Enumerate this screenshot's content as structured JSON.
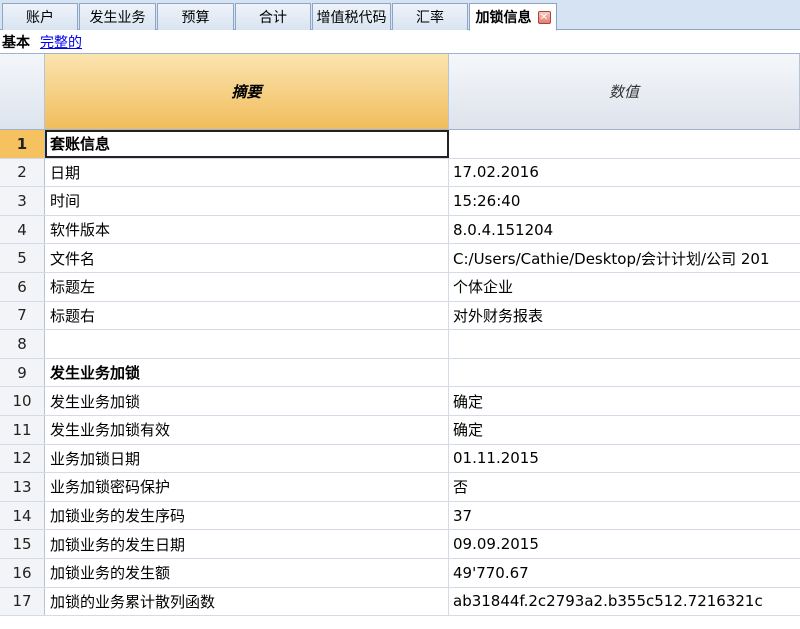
{
  "tabs": [
    {
      "label": "账户"
    },
    {
      "label": "发生业务"
    },
    {
      "label": "预算"
    },
    {
      "label": "合计"
    },
    {
      "label": "增值税代码"
    },
    {
      "label": "汇率"
    },
    {
      "label": "加锁信息",
      "active": true
    }
  ],
  "views": {
    "current": "基本",
    "other": "完整的"
  },
  "columns": {
    "desc": "摘要",
    "value": "数值"
  },
  "rows": [
    {
      "n": "1",
      "desc": "套账信息",
      "value": ""
    },
    {
      "n": "2",
      "desc": "日期",
      "value": "17.02.2016"
    },
    {
      "n": "3",
      "desc": "时间",
      "value": "15:26:40"
    },
    {
      "n": "4",
      "desc": "软件版本",
      "value": "8.0.4.151204"
    },
    {
      "n": "5",
      "desc": "文件名",
      "value": "C:/Users/Cathie/Desktop/会计计划/公司 201"
    },
    {
      "n": "6",
      "desc": "标题左",
      "value": "个体企业"
    },
    {
      "n": "7",
      "desc": "标题右",
      "value": "对外财务报表"
    },
    {
      "n": "8",
      "desc": "",
      "value": ""
    },
    {
      "n": "9",
      "desc": "发生业务加锁",
      "value": ""
    },
    {
      "n": "10",
      "desc": "发生业务加锁",
      "value": "确定"
    },
    {
      "n": "11",
      "desc": "发生业务加锁有效",
      "value": "确定"
    },
    {
      "n": "12",
      "desc": "业务加锁日期",
      "value": "01.11.2015"
    },
    {
      "n": "13",
      "desc": "业务加锁密码保护",
      "value": "否"
    },
    {
      "n": "14",
      "desc": "加锁业务的发生序码",
      "value": "37"
    },
    {
      "n": "15",
      "desc": "加锁业务的发生日期",
      "value": "09.09.2015"
    },
    {
      "n": "16",
      "desc": "加锁业务的发生额",
      "value": "49'770.67"
    },
    {
      "n": "17",
      "desc": "加锁的业务累计散列函数",
      "value": "ab31844f.2c2793a2.b355c512.7216321c"
    }
  ]
}
